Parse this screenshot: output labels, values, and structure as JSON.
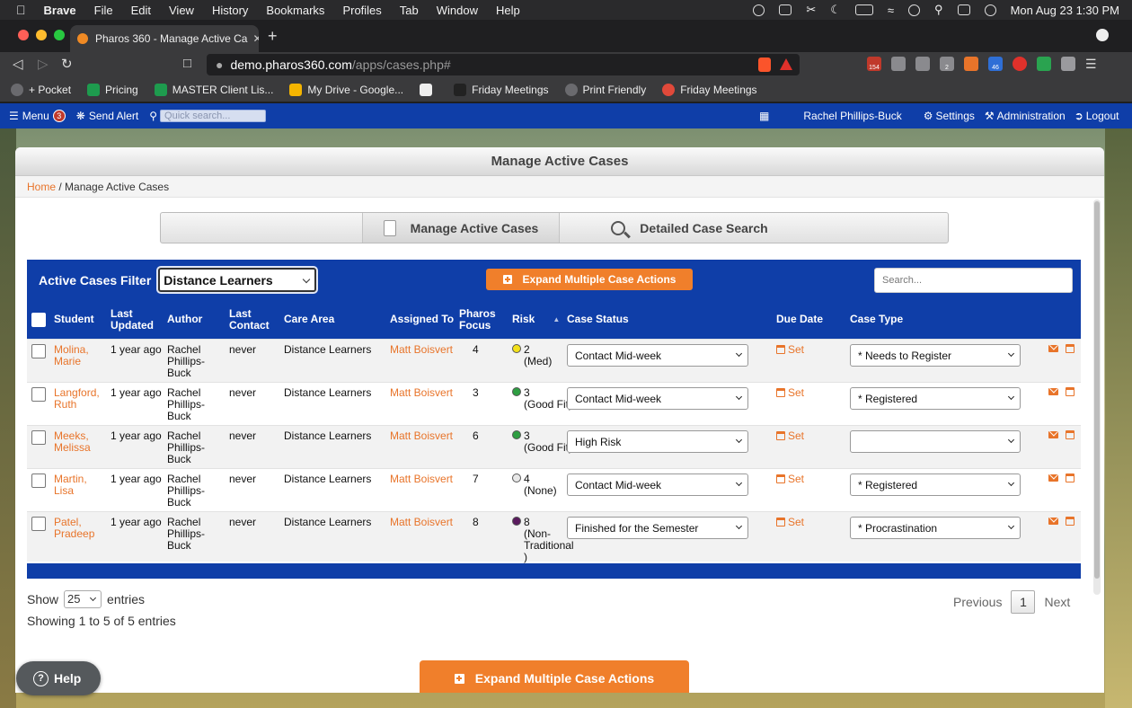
{
  "macbar": {
    "app": "Brave",
    "menus": [
      "File",
      "Edit",
      "View",
      "History",
      "Bookmarks",
      "Profiles",
      "Tab",
      "Window",
      "Help"
    ],
    "clock": "Mon Aug 23  1:30 PM"
  },
  "browser": {
    "tab_title": "Pharos 360 - Manage Active Ca",
    "url_host": "demo.pharos360.com",
    "url_path": "/apps/cases.php#",
    "shield_count": "1",
    "ext_badges": [
      "154",
      "2",
      "46"
    ],
    "bookmarks": [
      "+ Pocket",
      "Pricing",
      "MASTER Client Lis...",
      "My Drive - Google...",
      "",
      "Friday Meetings",
      "Print Friendly",
      "Friday Meetings"
    ]
  },
  "appnav": {
    "menu": "Menu",
    "menu_badge": "3",
    "send_alert": "Send Alert",
    "quick_search_placeholder": "Quick search...",
    "user": "Rachel Phillips-Buck",
    "settings": "Settings",
    "administration": "Administration",
    "logout": "Logout"
  },
  "page": {
    "title": "Manage Active Cases",
    "breadcrumb_home": "Home",
    "breadcrumb_current": " / Manage Active Cases",
    "tab_manage": "Manage Active Cases",
    "tab_search": "Detailed Case Search"
  },
  "filter": {
    "label": "Active Cases Filter",
    "selected": "Distance Learners",
    "expand_label": "Expand Multiple Case Actions",
    "search_placeholder": "Search..."
  },
  "table": {
    "headers": {
      "student": "Student",
      "last_updated": [
        "Last",
        "Updated"
      ],
      "author": "Author",
      "last_contact": [
        "Last",
        "Contact"
      ],
      "care_area": "Care Area",
      "assigned_to": "Assigned To",
      "pharos_focus": [
        "Pharos",
        "Focus"
      ],
      "risk": "Risk",
      "case_status": "Case Status",
      "due_date": "Due Date",
      "case_type": "Case Type"
    },
    "rows": [
      {
        "student": [
          "Molina,",
          "Marie"
        ],
        "updated": "1 year ago",
        "author": [
          "Rachel",
          "Phillips-",
          "Buck"
        ],
        "contact": "never",
        "care": "Distance Learners",
        "assigned": "Matt Boisvert",
        "focus": "4",
        "risk": [
          "2",
          "(Med)"
        ],
        "risk_color": "#f3e11b",
        "status": "Contact Mid-week",
        "due": "Set",
        "type": "* Needs to Register"
      },
      {
        "student": [
          "Langford,",
          "Ruth"
        ],
        "updated": "1 year ago",
        "author": [
          "Rachel",
          "Phillips-",
          "Buck"
        ],
        "contact": "never",
        "care": "Distance Learners",
        "assigned": "Matt Boisvert",
        "focus": "3",
        "risk": [
          "3",
          "(Good Fit)"
        ],
        "risk_color": "#2e9e42",
        "status": "Contact Mid-week",
        "due": "Set",
        "type": "* Registered"
      },
      {
        "student": [
          "Meeks,",
          "Melissa"
        ],
        "updated": "1 year ago",
        "author": [
          "Rachel",
          "Phillips-",
          "Buck"
        ],
        "contact": "never",
        "care": "Distance Learners",
        "assigned": "Matt Boisvert",
        "focus": "6",
        "risk": [
          "3",
          "(Good Fit)"
        ],
        "risk_color": "#2e9e42",
        "status": "High Risk",
        "due": "Set",
        "type": ""
      },
      {
        "student": [
          "Martin,",
          "Lisa"
        ],
        "updated": "1 year ago",
        "author": [
          "Rachel",
          "Phillips-",
          "Buck"
        ],
        "contact": "never",
        "care": "Distance Learners",
        "assigned": "Matt Boisvert",
        "focus": "7",
        "risk": [
          "4",
          "(None)"
        ],
        "risk_color": "#e8e8e8",
        "status": "Contact Mid-week",
        "due": "Set",
        "type": "* Registered"
      },
      {
        "student": [
          "Patel,",
          "Pradeep"
        ],
        "updated": "1 year ago",
        "author": [
          "Rachel",
          "Phillips-",
          "Buck"
        ],
        "contact": "never",
        "care": "Distance Learners",
        "assigned": "Matt Boisvert",
        "focus": "8",
        "risk": [
          "8",
          "(Non-",
          "Traditional",
          ")"
        ],
        "risk_color": "#5a1b5e",
        "status": "Finished for the Semester",
        "due": "Set",
        "type": "* Procrastination"
      }
    ]
  },
  "footer": {
    "show": "Show",
    "entries_count": "25",
    "entries": "entries",
    "info": "Showing 1 to 5 of 5 entries",
    "previous": "Previous",
    "page": "1",
    "next": "Next",
    "expand_label": "Expand Multiple Case Actions",
    "help": "Help"
  }
}
